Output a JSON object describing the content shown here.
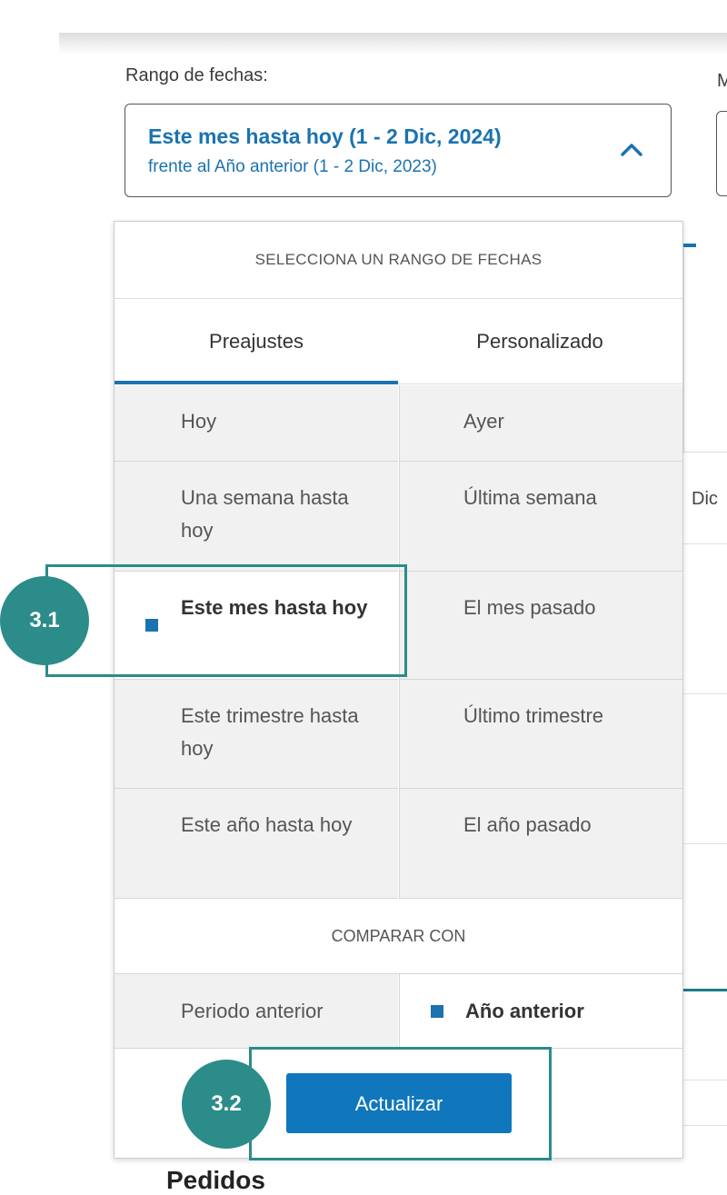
{
  "range_label": "Rango de fechas:",
  "second_label": "M",
  "range_select": {
    "main": "Este mes hasta hoy (1 - 2 Dic, 2024)",
    "compare": "frente al Año anterior (1 - 2 Dic, 2023)"
  },
  "dropdown": {
    "header": "SELECCIONA UN RANGO DE FECHAS",
    "tabs": [
      "Preajustes",
      "Personalizado"
    ],
    "presets": [
      [
        "Hoy",
        "Ayer"
      ],
      [
        "Una semana hasta hoy",
        "Última semana"
      ],
      [
        "Este mes hasta hoy",
        "El mes pasado"
      ],
      [
        "Este trimestre hasta hoy",
        "Último trimestre"
      ],
      [
        "Este año hasta hoy",
        "El año pasado"
      ]
    ],
    "selected_preset": "Este mes hasta hoy",
    "compare_header": "COMPARAR CON",
    "compare_options": [
      "Periodo anterior",
      "Año anterior"
    ],
    "selected_compare": "Año anterior",
    "update_button": "Actualizar"
  },
  "background": {
    "dic_label": "Dic",
    "section_title": "Pedidos"
  },
  "callouts": [
    "3.1",
    "3.2"
  ],
  "colors": {
    "accent_blue": "#1a73b0",
    "button_blue": "#1077bc",
    "callout_teal": "#2b8c89",
    "cell_bg": "#f1f1f1"
  }
}
